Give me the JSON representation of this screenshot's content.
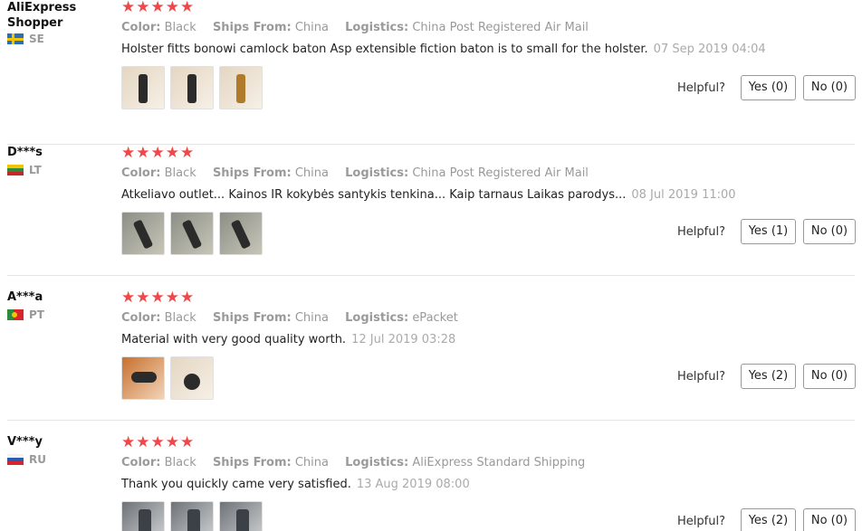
{
  "stars": "★★★★★",
  "labels": {
    "color": "Color:",
    "ships_from": "Ships From:",
    "logistics": "Logistics:",
    "helpful": "Helpful?"
  },
  "reviews": [
    {
      "user": "AliExpress Shopper",
      "country": "SE",
      "color": "Black",
      "ships_from": "China",
      "logistics": "China Post Registered Air Mail",
      "text": "Holster fitts bonowi camlock baton Asp extensible fiction baton is to small for the holster.",
      "date": "07 Sep 2019 04:04",
      "yes": "Yes (0)",
      "no": "No (0)"
    },
    {
      "user": "D***s",
      "country": "LT",
      "color": "Black",
      "ships_from": "China",
      "logistics": "China Post Registered Air Mail",
      "text": "Atkeliavo outlet... Kainos IR kokybės santykis tenkina... Kaip tarnaus Laikas parodys...",
      "date": "08 Jul 2019 11:00",
      "yes": "Yes (1)",
      "no": "No (0)"
    },
    {
      "user": "A***a",
      "country": "PT",
      "color": "Black",
      "ships_from": "China",
      "logistics": "ePacket",
      "text": "Material with very good quality worth.",
      "date": "12 Jul 2019 03:28",
      "yes": "Yes (2)",
      "no": "No (0)"
    },
    {
      "user": "V***y",
      "country": "RU",
      "color": "Black",
      "ships_from": "China",
      "logistics": "AliExpress Standard Shipping",
      "text": "Thank you quickly came very satisfied.",
      "date": "13 Aug 2019 08:00",
      "yes": "Yes (2)",
      "no": "No (0)"
    }
  ],
  "colors": {
    "star": "#f04848",
    "muted": "#999999",
    "divider": "#e6e6e6"
  }
}
